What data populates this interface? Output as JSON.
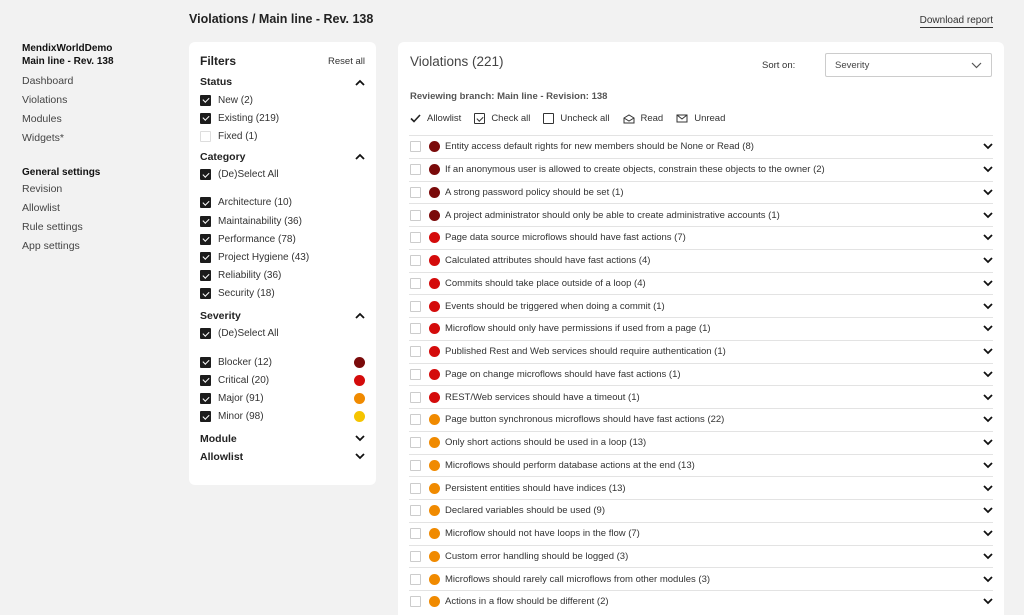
{
  "header": {
    "title": "Violations / Main line - Rev. 138",
    "download": "Download report"
  },
  "nav": {
    "project_line1": "MendixWorldDemo",
    "project_line2": "Main line - Rev. 138",
    "items": [
      "Dashboard",
      "Violations",
      "Modules",
      "Widgets*"
    ],
    "general_title": "General settings",
    "general_items": [
      "Revision",
      "Allowlist",
      "Rule settings",
      "App settings"
    ]
  },
  "filters": {
    "title": "Filters",
    "reset": "Reset all",
    "status": {
      "title": "Status",
      "options": [
        {
          "label": "New (2)",
          "checked": true
        },
        {
          "label": "Existing (219)",
          "checked": true
        },
        {
          "label": "Fixed (1)",
          "checked": false
        }
      ]
    },
    "category": {
      "title": "Category",
      "select_all": "(De)Select All",
      "options": [
        {
          "label": "Architecture (10)",
          "checked": true
        },
        {
          "label": "Maintainability (36)",
          "checked": true
        },
        {
          "label": "Performance (78)",
          "checked": true
        },
        {
          "label": "Project Hygiene (43)",
          "checked": true
        },
        {
          "label": "Reliability (36)",
          "checked": true
        },
        {
          "label": "Security (18)",
          "checked": true
        }
      ]
    },
    "severity": {
      "title": "Severity",
      "select_all": "(De)Select All",
      "options": [
        {
          "label": "Blocker (12)",
          "checked": true,
          "color": "#7a0a0a"
        },
        {
          "label": "Critical (20)",
          "checked": true,
          "color": "#d40b0b"
        },
        {
          "label": "Major (91)",
          "checked": true,
          "color": "#f08a00"
        },
        {
          "label": "Minor (98)",
          "checked": true,
          "color": "#f5c400"
        }
      ]
    },
    "module": {
      "title": "Module"
    },
    "allowlist": {
      "title": "Allowlist"
    }
  },
  "violations": {
    "title": "Violations (221)",
    "sort_label": "Sort on:",
    "sort_value": "Severity",
    "branch": "Reviewing branch: Main line - Revision: 138",
    "toolbar": {
      "allowlist": "Allowlist",
      "check_all": "Check all",
      "uncheck_all": "Uncheck all",
      "read": "Read",
      "unread": "Unread"
    },
    "rows": [
      {
        "text": "Entity access default rights for new members should be None or Read (8)",
        "color": "#7a0a0a"
      },
      {
        "text": "If an anonymous user is allowed to create objects, constrain these objects to the owner (2)",
        "color": "#7a0a0a"
      },
      {
        "text": "A strong password policy should be set (1)",
        "color": "#7a0a0a"
      },
      {
        "text": "A project administrator should only be able to create administrative accounts (1)",
        "color": "#7a0a0a"
      },
      {
        "text": "Page data source microflows should have fast actions (7)",
        "color": "#d40b0b"
      },
      {
        "text": "Calculated attributes should have fast actions (4)",
        "color": "#d40b0b"
      },
      {
        "text": "Commits should take place outside of a loop (4)",
        "color": "#d40b0b"
      },
      {
        "text": "Events should be triggered when doing a commit (1)",
        "color": "#d40b0b"
      },
      {
        "text": "Microflow should only have permissions if used from a page (1)",
        "color": "#d40b0b"
      },
      {
        "text": "Published Rest and Web services should require authentication (1)",
        "color": "#d40b0b"
      },
      {
        "text": "Page on change microflows should have fast actions (1)",
        "color": "#d40b0b"
      },
      {
        "text": "REST/Web services should have a timeout (1)",
        "color": "#d40b0b"
      },
      {
        "text": "Page button synchronous microflows should have fast actions (22)",
        "color": "#f08a00"
      },
      {
        "text": "Only short actions should be used in a loop (13)",
        "color": "#f08a00"
      },
      {
        "text": "Microflows should perform database actions at the end (13)",
        "color": "#f08a00"
      },
      {
        "text": "Persistent entities should have indices (13)",
        "color": "#f08a00"
      },
      {
        "text": "Declared variables should be used (9)",
        "color": "#f08a00"
      },
      {
        "text": "Microflow should not have loops in the flow (7)",
        "color": "#f08a00"
      },
      {
        "text": "Custom error handling should be logged (3)",
        "color": "#f08a00"
      },
      {
        "text": "Microflows should rarely call microflows from other modules (3)",
        "color": "#f08a00"
      },
      {
        "text": "Actions in a flow should be different (2)",
        "color": "#f08a00"
      }
    ]
  }
}
